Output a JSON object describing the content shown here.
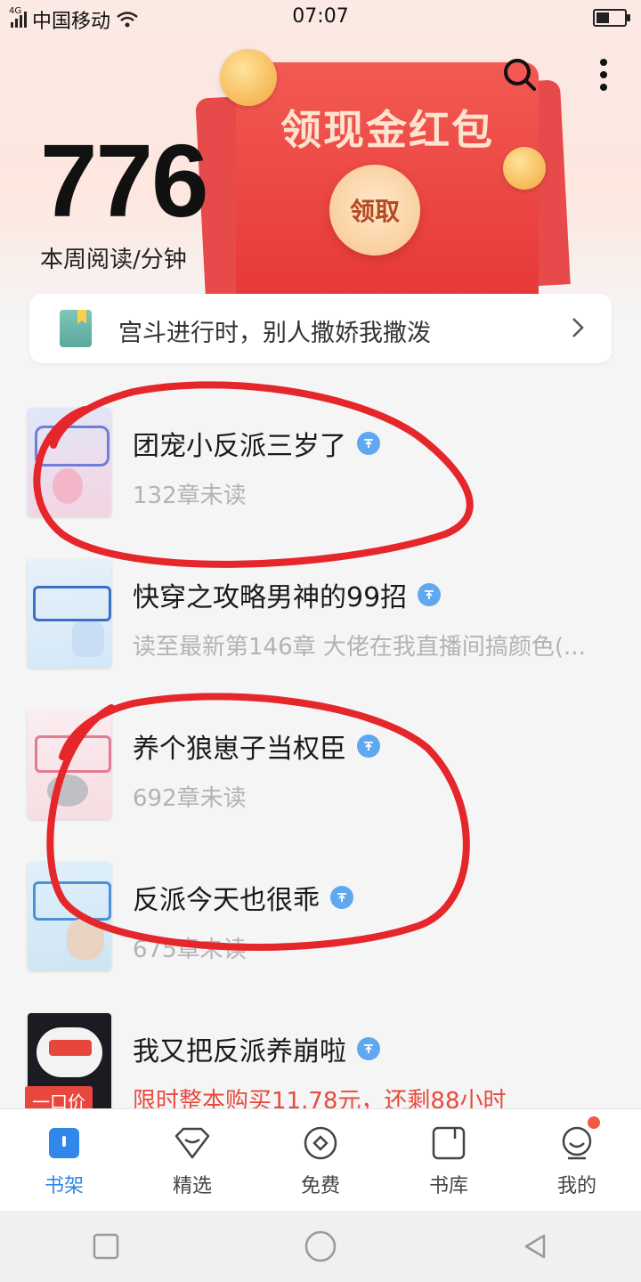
{
  "status_bar": {
    "carrier": "中国移动",
    "network_tag": "4G",
    "time": "07:07",
    "battery_level": 0.45
  },
  "header": {
    "reading_minutes": "776",
    "reading_label": "本周阅读/分钟",
    "search_icon": "search-icon",
    "more_icon": "more-vertical-icon"
  },
  "red_packet": {
    "title": "领现金红包",
    "button_label": "领取"
  },
  "banner": {
    "text": "宫斗进行时，别人撒娇我撒泼"
  },
  "books": [
    {
      "title": "团宠小反派三岁了",
      "subtitle": "132章未读",
      "subtitle_style": "gray"
    },
    {
      "title": "快穿之攻略男神的99招",
      "subtitle": "读至最新第146章 大佬在我直播间搞颜色(...",
      "subtitle_style": "gray"
    },
    {
      "title": "养个狼崽子当权臣",
      "subtitle": "692章未读",
      "subtitle_style": "gray"
    },
    {
      "title": "反派今天也很乖",
      "subtitle": "675章未读",
      "subtitle_style": "gray"
    },
    {
      "title": "我又把反派养崩啦",
      "subtitle": "限时整本购买11.78元，还剩88小时",
      "subtitle_style": "red",
      "badge": "一口价"
    }
  ],
  "bottom_nav": [
    {
      "label": "书架",
      "icon": "bookshelf-icon",
      "active": true
    },
    {
      "label": "精选",
      "icon": "diamond-icon",
      "active": false
    },
    {
      "label": "免费",
      "icon": "coin-icon",
      "active": false
    },
    {
      "label": "书库",
      "icon": "library-icon",
      "active": false
    },
    {
      "label": "我的",
      "icon": "profile-icon",
      "active": false,
      "notification": true
    }
  ],
  "colors": {
    "accent": "#2f88ea",
    "red_packet": "#e7393a",
    "annotation": "#e5262b"
  }
}
